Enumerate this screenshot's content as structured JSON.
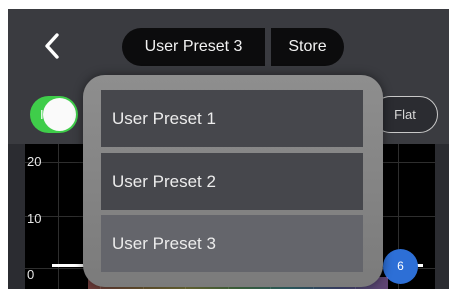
{
  "header": {
    "back_icon": "chevron-left-icon",
    "preset_label": "User Preset 3",
    "store_label": "Store"
  },
  "toolbar": {
    "toggle_label": "I",
    "toggle_on": true,
    "flat_label": "Flat"
  },
  "graph": {
    "y_labels": [
      "20",
      "10",
      "0"
    ],
    "band_label": "6"
  },
  "popup": {
    "items": [
      {
        "label": "User Preset 1",
        "selected": false
      },
      {
        "label": "User Preset 2",
        "selected": false
      },
      {
        "label": "User Preset 3",
        "selected": true
      }
    ]
  },
  "colors": {
    "accent_green": "#3fcd4a",
    "band_blue": "#2d6fd6",
    "header_bg": "#3a3b40",
    "pill_bg": "#0c0c0d"
  }
}
